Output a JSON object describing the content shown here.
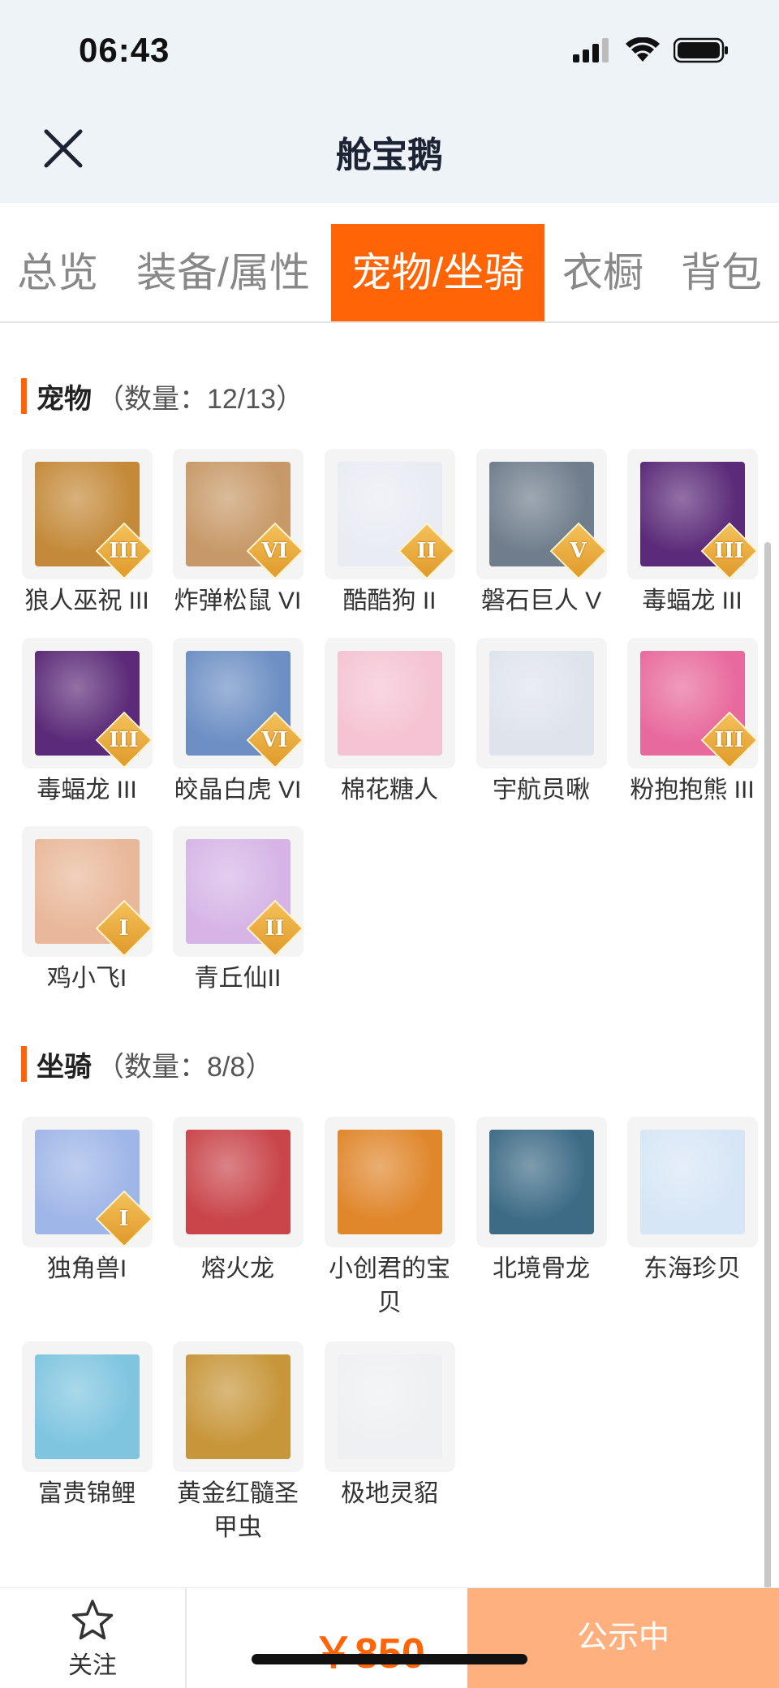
{
  "status_bar": {
    "time": "06:43"
  },
  "nav": {
    "title": "舱宝鹅"
  },
  "tabs": [
    {
      "label": "总览",
      "active": false
    },
    {
      "label": "装备/属性",
      "active": false
    },
    {
      "label": "宠物/坐骑",
      "active": true
    },
    {
      "label": "衣橱",
      "active": false
    },
    {
      "label": "背包",
      "active": false
    }
  ],
  "pets": {
    "title": "宠物",
    "count_text": "（数量：12/13）",
    "items": [
      {
        "name": "狼人巫祝 III",
        "badge": "III",
        "color": "#c48a3a"
      },
      {
        "name": "炸弹松鼠 VI",
        "badge": "VI",
        "color": "#c79968"
      },
      {
        "name": "酷酷狗 II",
        "badge": "II",
        "color": "#e9ecf3"
      },
      {
        "name": "磐石巨人 V",
        "badge": "V",
        "color": "#6f7d8c"
      },
      {
        "name": "毒蝠龙 III",
        "badge": "III",
        "color": "#5b2a78"
      },
      {
        "name": "毒蝠龙 III",
        "badge": "III",
        "color": "#5b2a78"
      },
      {
        "name": "皎晶白虎 VI",
        "badge": "VI",
        "color": "#6d8fc4"
      },
      {
        "name": "棉花糖人",
        "badge": "",
        "color": "#f5c3d3"
      },
      {
        "name": "宇航员啾",
        "badge": "",
        "color": "#dfe4ec"
      },
      {
        "name": "粉抱抱熊 III",
        "badge": "III",
        "color": "#e86a9c"
      },
      {
        "name": "鸡小飞I",
        "badge": "I",
        "color": "#e9b89a"
      },
      {
        "name": "青丘仙II",
        "badge": "II",
        "color": "#d6b5e6"
      }
    ]
  },
  "mounts": {
    "title": "坐骑",
    "count_text": "（数量：8/8）",
    "items": [
      {
        "name": "独角兽I",
        "badge": "I",
        "color": "#9fb6e8"
      },
      {
        "name": "熔火龙",
        "badge": "",
        "color": "#c9454a"
      },
      {
        "name": "小创君的宝贝",
        "badge": "",
        "color": "#e0862b"
      },
      {
        "name": "北境骨龙",
        "badge": "",
        "color": "#3d6b86"
      },
      {
        "name": "东海珍贝",
        "badge": "",
        "color": "#d7e6f6"
      },
      {
        "name": "富贵锦鲤",
        "badge": "",
        "color": "#7fc5e0"
      },
      {
        "name": "黄金红髓圣甲虫",
        "badge": "",
        "color": "#c7963a"
      },
      {
        "name": "极地灵貂",
        "badge": "",
        "color": "#eef0f2"
      }
    ]
  },
  "bottom": {
    "follow_label": "关注",
    "price": "￥850",
    "status_label": "公示中"
  }
}
